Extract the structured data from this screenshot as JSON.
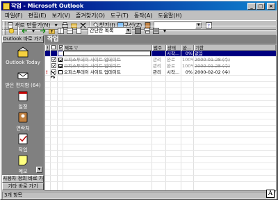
{
  "window": {
    "title": "작업 - Microsoft Outlook"
  },
  "menu": [
    "파일(F)",
    "편집(E)",
    "보기(V)",
    "즐겨찾기(O)",
    "도구(T)",
    "동작(A)",
    "도움말(H)"
  ],
  "toolbar1": {
    "new_label": "새로 만들기(N)",
    "find_label": "찾기(I)",
    "organize_label": "구성(Z)"
  },
  "toolbar2": {
    "view_combo": "간단한 목록"
  },
  "outlook_bar": {
    "header": "Outlook 바로 가기",
    "shortcuts": [
      {
        "label": "Outlook Today",
        "icon": "outlook-today-icon"
      },
      {
        "label": "받은 편지함 (64)",
        "icon": "inbox-icon"
      },
      {
        "label": "일정",
        "icon": "calendar-icon"
      },
      {
        "label": "연락처",
        "icon": "contacts-icon"
      },
      {
        "label": "작업",
        "icon": "tasks-icon"
      },
      {
        "label": "메모",
        "icon": "notes-icon"
      }
    ],
    "group2": "사용자 정의 바로 가기",
    "group3": "기타 바로 가기"
  },
  "folder": {
    "name": "작업"
  },
  "grid": {
    "columns": [
      "!",
      "",
      "",
      "제목",
      "범주",
      "상태",
      "완...",
      "기한"
    ],
    "new_row": {
      "subject": "",
      "category": "시작...",
      "percent": "0%",
      "due": "없음"
    },
    "rows": [
      {
        "subject": "오피스투데이 사이트 업데이트",
        "category": "관리",
        "status": "완료",
        "percent": "100%",
        "due": "2000-01-28 (수)",
        "completed": true
      },
      {
        "subject": "오피스투데이 사이트 업데이트",
        "category": "관리",
        "status": "완료",
        "percent": "100%",
        "due": "2000-01-28 (수)",
        "completed": true
      },
      {
        "subject": "오피스투데이 사이트 업데이트",
        "category": "관리",
        "status": "시작...",
        "percent": "0%",
        "due": "2000-02-02 (수)",
        "completed": false
      }
    ]
  },
  "status": {
    "text": "3개 항목"
  },
  "ime": {
    "label": "A"
  },
  "colors": {
    "title_start": "#000080",
    "title_end": "#1084d0",
    "bar_bg": "#808080",
    "selection": "#000080"
  }
}
